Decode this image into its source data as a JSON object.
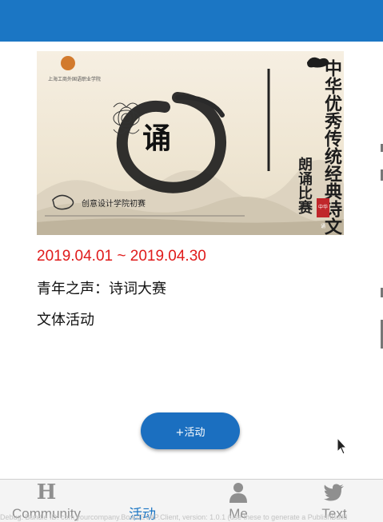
{
  "header": {
    "color": "#1b76c4"
  },
  "banner": {
    "center_char": "诵",
    "vertical_title": "中华优秀传统经典诗文",
    "vertical_sub": "朗诵比赛",
    "college_name": "创意设计学院初赛",
    "school_name": "上海工商外国语职业学院",
    "seal_text": "中华诵"
  },
  "event": {
    "date_range": "2019.04.01 ~ 2019.04.30",
    "title": "青年之声：诗词大赛",
    "category": "文体活动",
    "date_color": "#e01b1b"
  },
  "add_button": {
    "label": "+活动",
    "color": "#1b6fc0"
  },
  "tabs": [
    {
      "label": "Community",
      "icon": "h-icon",
      "active": false
    },
    {
      "label": "活动",
      "icon": "none",
      "active": true
    },
    {
      "label": "Me",
      "icon": "user-icon",
      "active": false
    },
    {
      "label": "Text",
      "icon": "twitter-icon",
      "active": false
    }
  ],
  "debug_text": "Debug. Bundle ID: com.yourcompany.BoardEVAP.Client, version: 1.0.1 (use these to generate a PublishBuild"
}
